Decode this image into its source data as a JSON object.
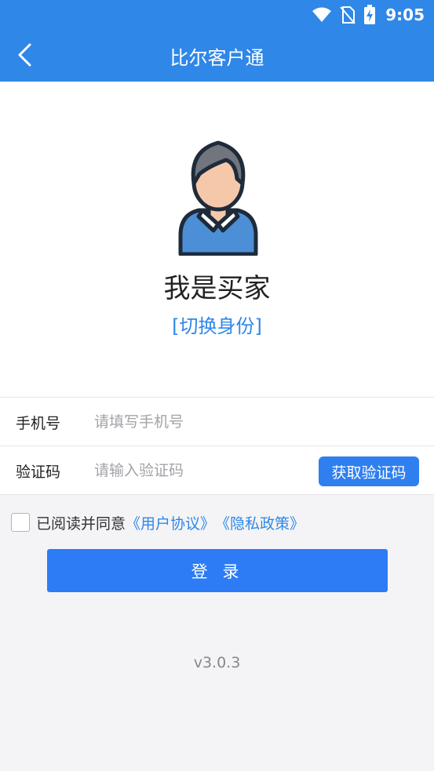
{
  "status_bar": {
    "time": "9:05"
  },
  "header": {
    "title": "比尔客户通"
  },
  "profile": {
    "role_title": "我是买家",
    "switch_label": "[切换身份]"
  },
  "form": {
    "phone_label": "手机号",
    "phone_placeholder": "请填写手机号",
    "code_label": "验证码",
    "code_placeholder": "请输入验证码",
    "get_code_label": "获取验证码"
  },
  "agreement": {
    "prefix": "已阅读并同意",
    "user_agreement": "《用户协议》",
    "privacy_policy": "《隐私政策》"
  },
  "login_label": "登 录",
  "version": "v3.0.3",
  "icons": [
    "wifi-icon",
    "no-sim-icon",
    "battery-charging-icon",
    "back-arrow-icon",
    "user-avatar-icon",
    "checkbox-icon"
  ],
  "colors": {
    "primary": "#2f87e8",
    "button": "#2d7cf6",
    "background": "#f4f4f6"
  }
}
